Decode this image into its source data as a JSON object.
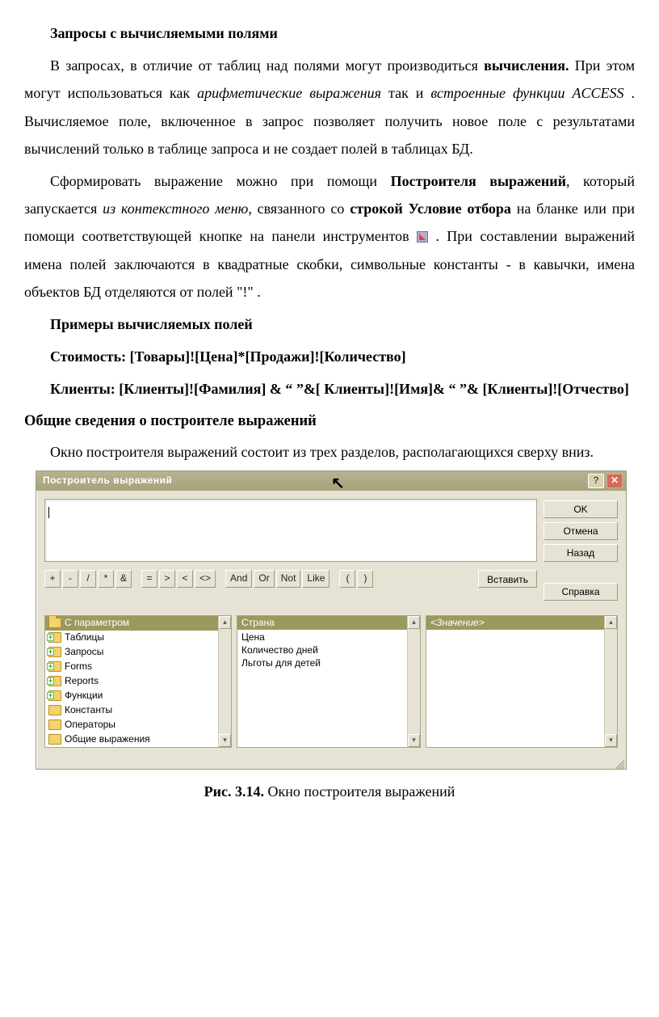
{
  "doc": {
    "h1": "Запросы с вычисляемыми полями",
    "p1_a": "В запросах, в отличие от таблиц над полями могут производиться ",
    "p1_b": "вычисления.",
    "p1_c": " При этом могут использоваться как  ",
    "p1_d": "арифметические выражения",
    "p1_e": " так и ",
    "p1_f": "встроенные функции ACCESS ",
    "p1_g": ". Вычисляемое поле, включенное в запрос позволяет получить новое поле с результатами вычислений только в таблице запроса и не создает полей в таблицах БД.",
    "p2_a": "Сформировать выражение можно при помощи ",
    "p2_b": "Построителя выражений",
    "p2_c": ", который запускается ",
    "p2_d": "из контекстного меню",
    "p2_e": ", связанного со ",
    "p2_f": "строкой Условие отбора",
    "p2_g": " на бланке или при помощи соответствующей кнопке на панели инструментов  ",
    "p2_h": " . При составлении выражений имена полей заключаются в квадратные скобки, символьные константы - в кавычки, имена объектов БД отделяются от полей \"!\"  .",
    "examples_h": "Примеры вычисляемых полей",
    "ex1": "Стоимость: [Товары]![Цена]*[Продажи]![Количество]",
    "ex2": "Клиенты: [Клиенты]![Фамилия] & “ ”&[ Клиенты]![Имя]& “ ”& [Клиенты]![Отчество]",
    "h2": "Общие сведения о построителе выражений",
    "p3": "Окно построителя выражений состоит из трех разделов, располагающихся сверху вниз.",
    "caption_b": "Рис. 3.14.",
    "caption_r": " Окно построителя выражений"
  },
  "builder": {
    "title": "Построитель выражений",
    "help_glyph": "?",
    "close_glyph": "✕",
    "cursor_glyph": "↖",
    "buttons": {
      "ok": "OK",
      "cancel": "Отмена",
      "back": "Назад",
      "help": "Справка",
      "insert": "Вставить"
    },
    "operators": [
      "+",
      "-",
      "/",
      "*",
      "&",
      "=",
      ">",
      "<",
      "<>",
      "And",
      "Or",
      "Not",
      "Like",
      "(",
      ")"
    ],
    "categories": [
      {
        "label": "С параметром",
        "type": "open",
        "selected": true
      },
      {
        "label": "Таблицы",
        "type": "plus"
      },
      {
        "label": "Запросы",
        "type": "plus"
      },
      {
        "label": "Forms",
        "type": "plus"
      },
      {
        "label": "Reports",
        "type": "plus"
      },
      {
        "label": "Функции",
        "type": "plus"
      },
      {
        "label": "Константы",
        "type": "closed"
      },
      {
        "label": "Операторы",
        "type": "closed"
      },
      {
        "label": "Общие выражения",
        "type": "closed"
      }
    ],
    "fields_header": "Страна",
    "fields": [
      "Цена",
      "Количество дней",
      "Льготы для детей"
    ],
    "values_header": "<Значение>"
  }
}
